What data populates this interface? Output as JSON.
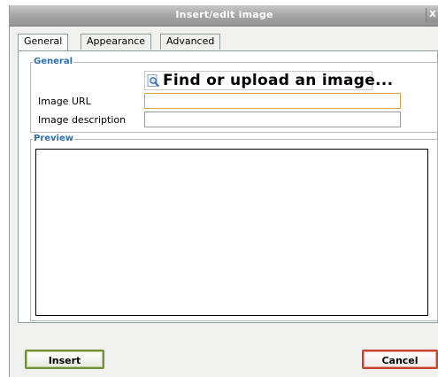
{
  "window": {
    "title": "Insert/edit image",
    "close_glyph": "X"
  },
  "tabs": [
    {
      "label": "General",
      "active": true
    },
    {
      "label": "Appearance",
      "active": false
    },
    {
      "label": "Advanced",
      "active": false
    }
  ],
  "general": {
    "legend": "General",
    "find_button_label": "Find or upload an image...",
    "image_url_label": "Image URL",
    "image_url_value": "",
    "image_description_label": "Image description",
    "image_description_value": ""
  },
  "preview": {
    "legend": "Preview"
  },
  "buttons": {
    "insert": "Insert",
    "cancel": "Cancel"
  },
  "icons": {
    "find": "magnifier-icon",
    "close": "close-icon"
  },
  "colors": {
    "legend_text": "#2b6fb6",
    "insert_border": "#6f8f3d",
    "cancel_border": "#c4432f",
    "focused_input_border": "#d9a441"
  }
}
